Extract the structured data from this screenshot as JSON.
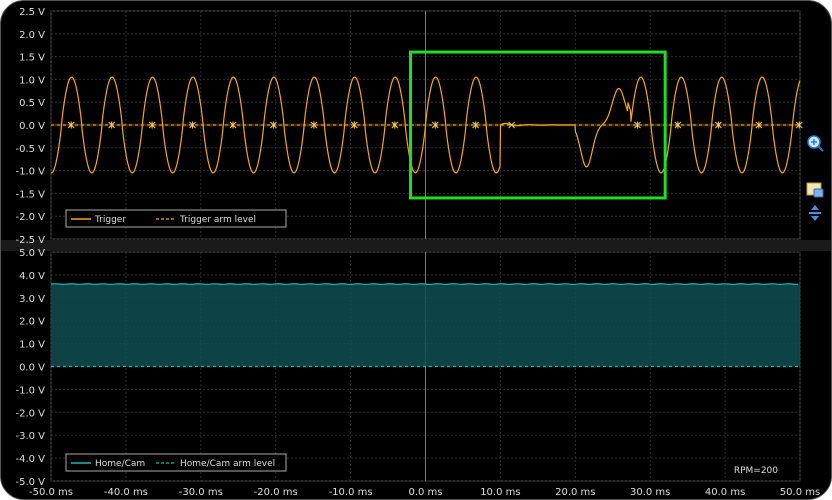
{
  "chart_data": [
    {
      "type": "line",
      "panel": "top",
      "ylim": [
        -2.5,
        2.5
      ],
      "xlim": [
        -50,
        50
      ],
      "y_ticks": [
        "2.5 V",
        "2.0 V",
        "1.5 V",
        "1.0 V",
        "0.5 V",
        "0.0 V",
        "-0.5 V",
        "-1.0 V",
        "-1.5 V",
        "-2.0 V",
        "-2.5 V"
      ],
      "grid": true,
      "legend_position": "bottom-left",
      "series": [
        {
          "name": "Trigger",
          "color": "#f5a623",
          "style": "solid",
          "period_ms": 5.4,
          "amplitude_v": 1.05,
          "gap_start_ms": 10,
          "gap_end_ms": 20,
          "pulse_down_ms": 21.5,
          "pulse_up_ms": 25.8
        },
        {
          "name": "Trigger arm level",
          "color": "#f5a623",
          "style": "dashed",
          "y": 0.0
        }
      ],
      "highlight_box": {
        "x_start_ms": -2,
        "x_end_ms": 32,
        "y_top_v": 1.6,
        "y_bottom_v": -1.6,
        "color": "#22dd22"
      }
    },
    {
      "type": "area",
      "panel": "bottom",
      "ylim": [
        -5.0,
        5.0
      ],
      "xlim": [
        -50,
        50
      ],
      "y_ticks": [
        "5.0 V",
        "4.0 V",
        "3.0 V",
        "2.0 V",
        "1.0 V",
        "0.0 V",
        "-1.0 V",
        "-2.0 V",
        "-3.0 V",
        "-4.0 V",
        "-5.0 V"
      ],
      "grid": true,
      "legend_position": "bottom-left",
      "series": [
        {
          "name": "Home/Cam",
          "color": "#1bb8b8",
          "style": "solid",
          "y": 3.6
        },
        {
          "name": "Home/Cam arm level",
          "color": "#1bb8b8",
          "style": "dashed",
          "y": 0.0
        }
      ],
      "annotation": "RPM=200"
    }
  ],
  "x_ticks": [
    "-50.0 ms",
    "-40.0 ms",
    "-30.0 ms",
    "-20.0 ms",
    "-10.0 ms",
    "0.0 ms",
    "10.0 ms",
    "20.0 ms",
    "30.0 ms",
    "40.0 ms",
    "50.0 ms"
  ],
  "icons": [
    "zoom-in-icon",
    "screenshot-icon",
    "vertical-expand-icon"
  ]
}
